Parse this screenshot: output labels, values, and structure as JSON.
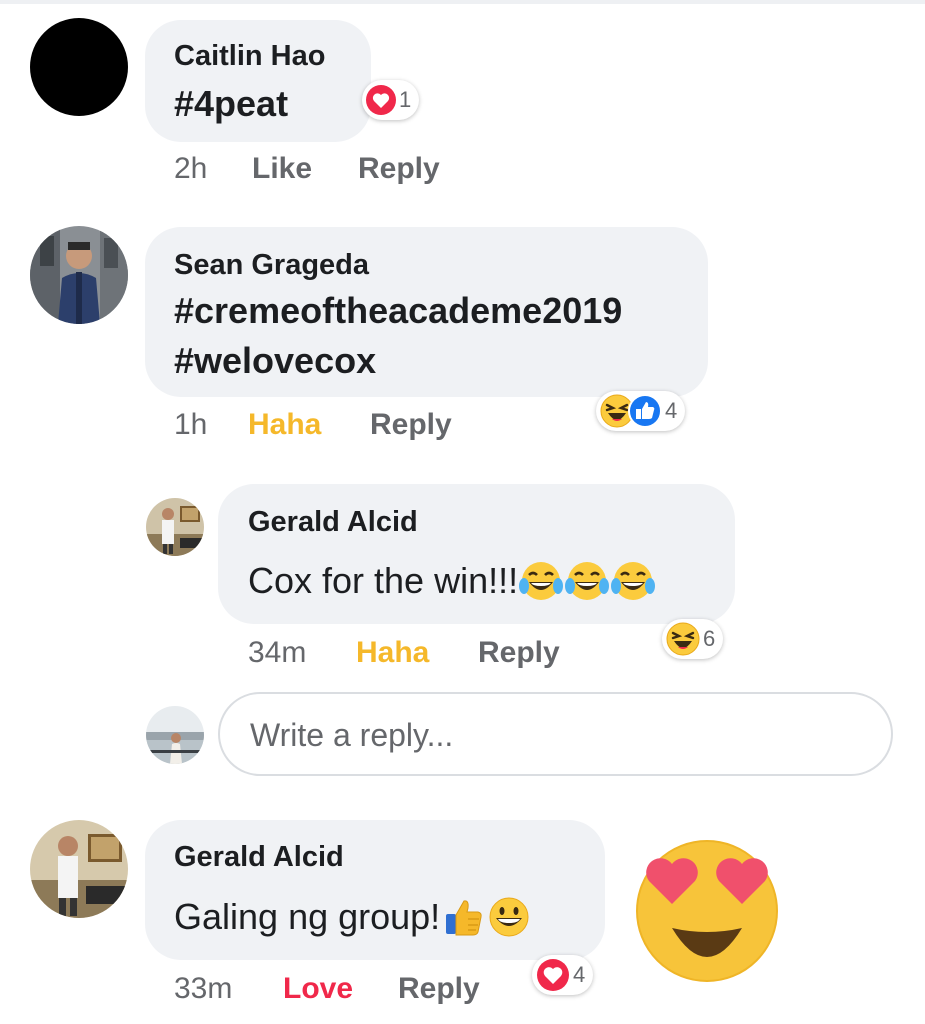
{
  "comments": [
    {
      "author": "Caitlin Hao",
      "text": "#4peat",
      "time": "2h",
      "like_label": "Like",
      "reply_label": "Reply",
      "reaction_count": "1",
      "reaction_icons": [
        "heart-icon"
      ]
    },
    {
      "author": "Sean Grageda",
      "text_line1": "#cremeoftheacademe2019",
      "text_line2": "#welovecox",
      "time": "1h",
      "like_label": "Haha",
      "reply_label": "Reply",
      "reaction_count": "4",
      "reaction_icons": [
        "laughing-face-icon",
        "thumbs-up-icon"
      ]
    }
  ],
  "nested_reply": {
    "author": "Gerald Alcid",
    "text": "Cox for the win!!!",
    "emojis": [
      "tears-of-joy-icon",
      "tears-of-joy-icon",
      "tears-of-joy-icon"
    ],
    "time": "34m",
    "like_label": "Haha",
    "reply_label": "Reply",
    "reaction_count": "6",
    "reaction_icons": [
      "laughing-face-icon"
    ]
  },
  "reply_input": {
    "placeholder": "Write a reply..."
  },
  "last_comment": {
    "author": "Gerald Alcid",
    "text": "Galing ng group!",
    "emojis": [
      "thumbs-up-emoji-icon",
      "grinning-face-icon"
    ],
    "time": "33m",
    "like_label": "Love",
    "reply_label": "Reply",
    "reaction_count": "4",
    "reaction_icons": [
      "heart-icon"
    ],
    "sticker": "heart-eyes-sticker"
  },
  "colors": {
    "bubble": "#f0f2f5",
    "secondary_text": "#65676b",
    "haha": "#f5b82a",
    "love": "#f0284a",
    "like_blue": "#1877f2"
  }
}
